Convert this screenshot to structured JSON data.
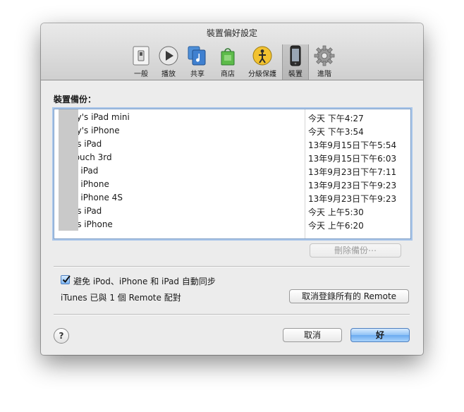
{
  "window": {
    "title": "裝置偏好設定"
  },
  "toolbar": {
    "items": [
      {
        "label": "一般",
        "icon": "general-switch-icon"
      },
      {
        "label": "播放",
        "icon": "play-icon"
      },
      {
        "label": "共享",
        "icon": "sharing-icon"
      },
      {
        "label": "商店",
        "icon": "store-bag-icon"
      },
      {
        "label": "分級保護",
        "icon": "parental-icon"
      },
      {
        "label": "裝置",
        "icon": "device-icon",
        "selected": true
      },
      {
        "label": "進階",
        "icon": "gear-icon"
      }
    ]
  },
  "backups": {
    "label": "裝置備份：",
    "rows": [
      {
        "name": "ny's iPad mini",
        "date": "今天 下午4:27"
      },
      {
        "name": "ny's iPhone",
        "date": "今天 下午3:54"
      },
      {
        "name": "r's iPad",
        "date": "13年9月15日下午5:54"
      },
      {
        "name": "touch 3rd",
        "date": "13年9月15日下午6:03"
      },
      {
        "name": "'s iPad",
        "date": "13年9月23日下午7:11"
      },
      {
        "name": "'s iPhone",
        "date": "13年9月23日下午9:23"
      },
      {
        "name": "'s iPhone 4S",
        "date": "13年9月23日下午9:23"
      },
      {
        "name": "r's iPad",
        "date": "今天 上午5:30"
      },
      {
        "name": "r's iPhone",
        "date": "今天 上午6:20"
      }
    ],
    "delete_label": "刪除備份⋯"
  },
  "sync": {
    "label": "避免 iPod、iPhone 和 iPad 自動同步",
    "checked": true
  },
  "remote": {
    "status": "iTunes 已與 1 個 Remote 配對",
    "unpair_label": "取消登錄所有的 Remote"
  },
  "footer": {
    "help": "?",
    "cancel_label": "取消",
    "ok_label": "好"
  },
  "colors": {
    "accent": "#6aaaf0",
    "list_border": "#7f9fc6"
  }
}
